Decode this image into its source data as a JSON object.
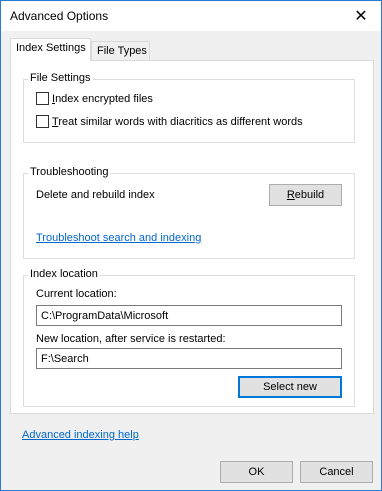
{
  "window": {
    "title": "Advanced Options",
    "close_glyph": "✕"
  },
  "tabs": [
    {
      "label": "Index Settings",
      "selected": true
    },
    {
      "label": "File Types",
      "selected": false
    }
  ],
  "file_settings": {
    "title": "File Settings",
    "options": [
      {
        "mnemonic": "I",
        "rest": "ndex encrypted files",
        "checked": false
      },
      {
        "mnemonic": "T",
        "rest": "reat similar words with diacritics as different words",
        "checked": false
      }
    ]
  },
  "troubleshooting": {
    "title": "Troubleshooting",
    "rebuild_text": "Delete and rebuild index",
    "rebuild_button_mnemonic": "R",
    "rebuild_button_rest": "ebuild",
    "link": "Troubleshoot search and indexing"
  },
  "index_location": {
    "title": "Index location",
    "current_label": "Current location:",
    "current_value": "C:\\ProgramData\\Microsoft",
    "new_label": "New location, after service is restarted:",
    "new_value": "F:\\Search",
    "select_button": "Select new"
  },
  "footer": {
    "help_link": "Advanced indexing help",
    "ok": "OK",
    "cancel": "Cancel"
  },
  "colors": {
    "accent": "#0078d7",
    "link": "#0066cc",
    "dialog_bg": "#f0f0f0"
  },
  "icons": {
    "close": "close-icon"
  }
}
